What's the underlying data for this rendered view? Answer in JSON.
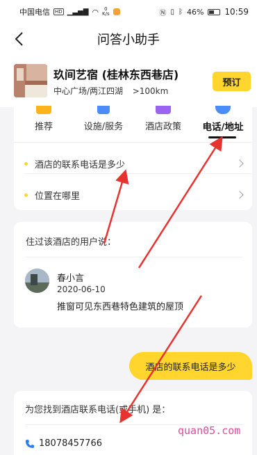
{
  "status_bar": {
    "carrier": "中国电信",
    "hd": "HD",
    "signal_gen": "5G",
    "net_speed_value": "0",
    "net_speed_unit": "K/s",
    "battery": "46%",
    "time": "10:59"
  },
  "nav": {
    "title": "问答小助手"
  },
  "hotel": {
    "name": "玖间艺宿 (桂林东西巷店)",
    "location": "中心广场/两江四湖",
    "distance": ">100km",
    "book_label": "预订"
  },
  "tabs": [
    {
      "label": "推荐",
      "icon": "recommend-icon",
      "color": "#ffb31a"
    },
    {
      "label": "设施/服务",
      "icon": "facility-icon",
      "color": "#4b8df8"
    },
    {
      "label": "酒店政策",
      "icon": "policy-icon",
      "color": "#9a64f0"
    },
    {
      "label": "电话/地址",
      "icon": "phone-address-icon",
      "color": "#4b8df8",
      "active": true
    }
  ],
  "questions": [
    {
      "text": "酒店的联系电话是多少"
    },
    {
      "text": "位置在哪里"
    }
  ],
  "review": {
    "heading": "住过该酒店的用户说：",
    "user": "春小言",
    "date": "2020-06-10",
    "text": "推窗可见东西巷特色建筑的屋顶"
  },
  "chat": {
    "user_message": "酒店的联系电话是多少"
  },
  "answer": {
    "heading": "为您找到酒店联系电话(或手机) 是：",
    "phone": "18078457766"
  },
  "watermark": "quan05.com",
  "colors": {
    "accent_yellow": "#ffd52e",
    "arrow_red": "#e8322d"
  }
}
